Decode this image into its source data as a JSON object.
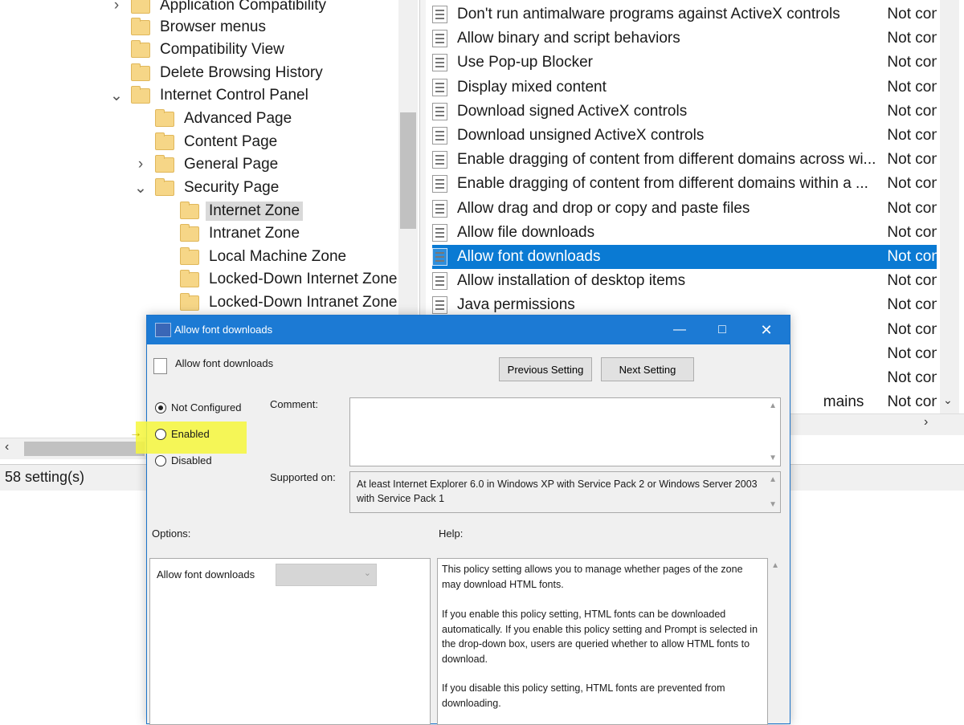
{
  "tree": {
    "items": [
      {
        "label": "Application Compatibility",
        "expander": "collapsed"
      },
      {
        "label": "Browser menus",
        "expander": ""
      },
      {
        "label": "Compatibility View",
        "expander": ""
      },
      {
        "label": "Delete Browsing History",
        "expander": ""
      },
      {
        "label": "Internet Control Panel",
        "expander": "expanded"
      },
      {
        "label": "Advanced Page",
        "expander": ""
      },
      {
        "label": "Content Page",
        "expander": ""
      },
      {
        "label": "General Page",
        "expander": "collapsed"
      },
      {
        "label": "Security Page",
        "expander": "expanded"
      },
      {
        "label": "Internet Zone",
        "expander": "",
        "selected": true
      },
      {
        "label": "Intranet Zone",
        "expander": ""
      },
      {
        "label": "Local Machine Zone",
        "expander": ""
      },
      {
        "label": "Locked-Down Internet Zone",
        "expander": ""
      },
      {
        "label": "Locked-Down Intranet Zone",
        "expander": ""
      }
    ]
  },
  "settings": {
    "rows": [
      {
        "name": "Don't run antimalware programs against ActiveX controls",
        "state": "Not con"
      },
      {
        "name": "Allow binary and script behaviors",
        "state": "Not con"
      },
      {
        "name": "Use Pop-up Blocker",
        "state": "Not con"
      },
      {
        "name": "Display mixed content",
        "state": "Not con"
      },
      {
        "name": "Download signed ActiveX controls",
        "state": "Not con"
      },
      {
        "name": "Download unsigned ActiveX controls",
        "state": "Not con"
      },
      {
        "name": "Enable dragging of content from different domains across wi...",
        "state": "Not con"
      },
      {
        "name": "Enable dragging of content from different domains within a ...",
        "state": "Not con"
      },
      {
        "name": "Allow drag and drop or copy and paste files",
        "state": "Not con"
      },
      {
        "name": "Allow file downloads",
        "state": "Not con"
      },
      {
        "name": "Allow font downloads",
        "state": "Not con",
        "selected": true
      },
      {
        "name": "Allow installation of desktop items",
        "state": "Not con"
      },
      {
        "name": "Java permissions",
        "state": "Not con"
      },
      {
        "name": "",
        "state": "Not con"
      },
      {
        "name": "",
        "state": "Not con"
      },
      {
        "name": "",
        "state": "Not con"
      },
      {
        "name": "mains",
        "state": "Not con"
      }
    ]
  },
  "status": {
    "text": "58 setting(s)"
  },
  "dialog": {
    "title": "Allow font downloads",
    "policy_name": "Allow font downloads",
    "prev_button": "Previous Setting",
    "next_button": "Next Setting",
    "radio": {
      "not_configured": "Not Configured",
      "enabled": "Enabled",
      "disabled": "Disabled",
      "selected": "not_configured",
      "highlighted": "enabled"
    },
    "comment_label": "Comment:",
    "comment_value": "",
    "supported_label": "Supported on:",
    "supported_text": "At least Internet Explorer 6.0 in Windows XP with Service Pack 2 or Windows Server 2003 with Service Pack 1",
    "options_label": "Options:",
    "help_label": "Help:",
    "option_name": "Allow font downloads",
    "option_value": "",
    "help": [
      "This policy setting allows you to manage whether pages of the zone may download HTML fonts.",
      "If you enable this policy setting, HTML fonts can be downloaded automatically. If you enable this policy setting and Prompt is selected in the drop-down box, users are queried whether to allow HTML fonts to download.",
      "If you disable this policy setting, HTML fonts are prevented from downloading."
    ]
  },
  "colors": {
    "selection": "#0a7ad3",
    "title_bar": "#1c7ad4",
    "highlight": "#f6f73c",
    "folder": "#f6d687"
  },
  "icons": {
    "tree_folder": "folder-icon",
    "policy": "policy-setting-icon",
    "expand": "chevron-right-icon",
    "collapse": "chevron-down-icon"
  }
}
